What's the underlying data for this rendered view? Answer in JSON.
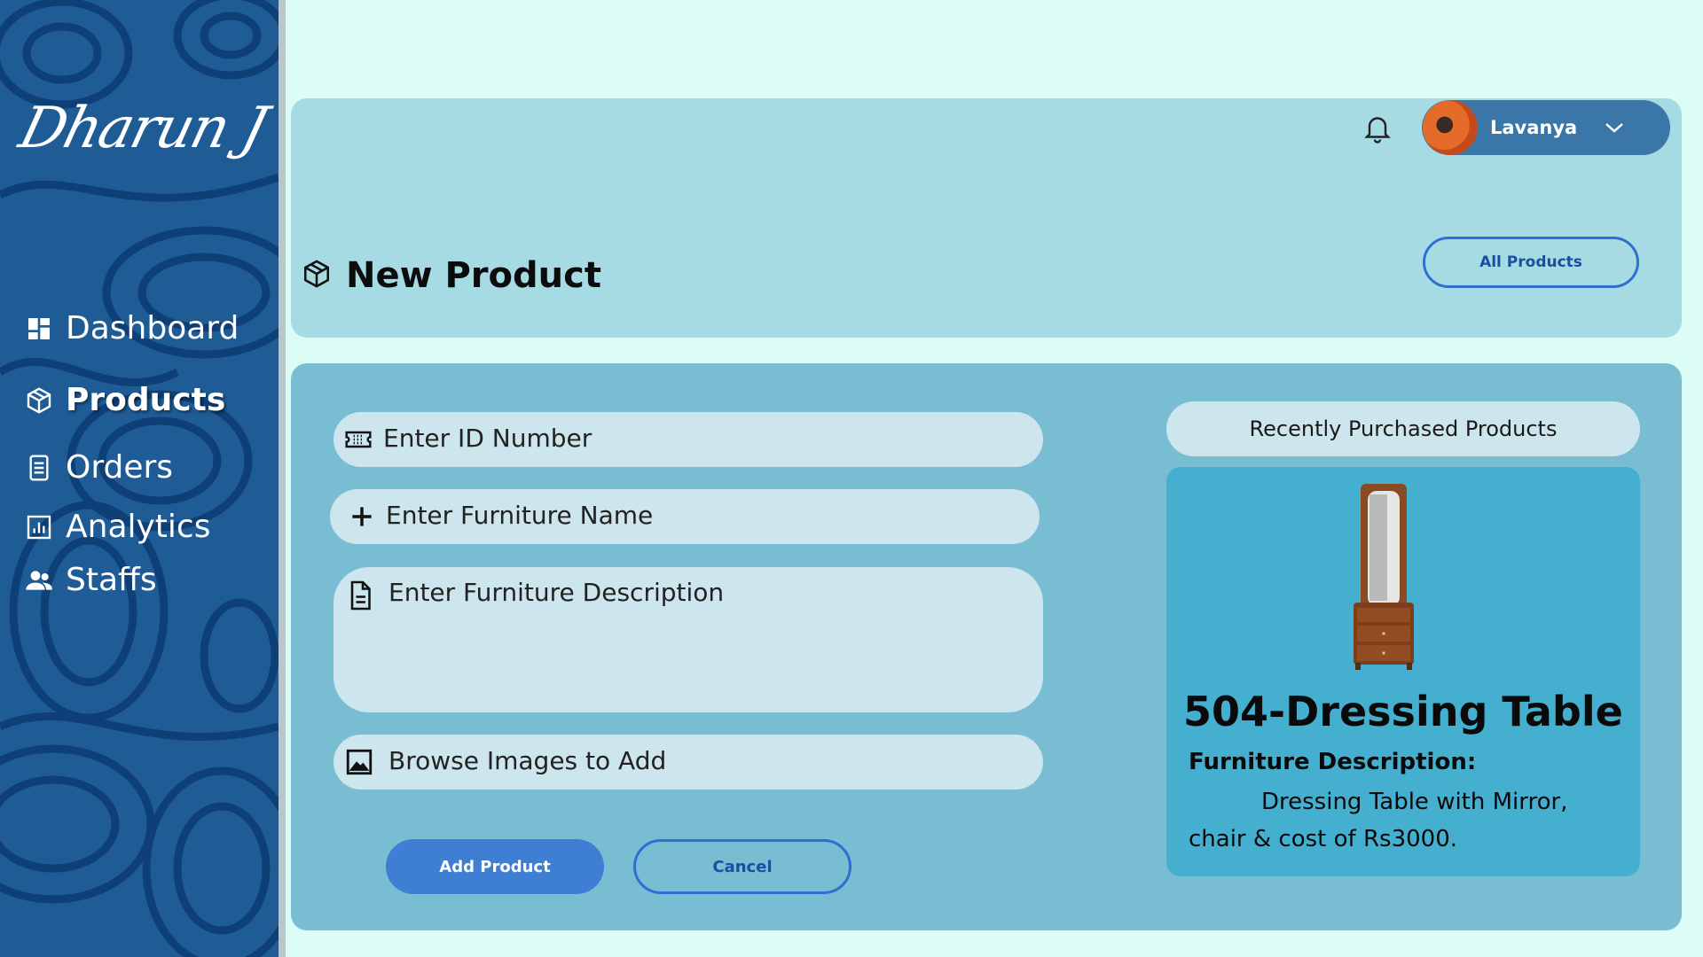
{
  "brand": {
    "signature": "Dharun J"
  },
  "sidebar": {
    "items": [
      {
        "label": "Dashboard",
        "icon": "dashboard-icon",
        "active": false
      },
      {
        "label": "Products",
        "icon": "box-icon",
        "active": true
      },
      {
        "label": "Orders",
        "icon": "orders-icon",
        "active": false
      },
      {
        "label": "Analytics",
        "icon": "analytics-icon",
        "active": false
      },
      {
        "label": "Staffs",
        "icon": "users-icon",
        "active": false
      }
    ]
  },
  "header": {
    "title": "New Product",
    "title_icon": "box-icon",
    "user_name": "Lavanya",
    "all_products_label": "All Products",
    "bell_icon": "bell-icon"
  },
  "form": {
    "id_placeholder": "Enter ID Number",
    "name_placeholder": "Enter Furniture Name",
    "description_placeholder": "Enter Furniture Description",
    "images_placeholder": "Browse Images to Add",
    "add_label": "Add Product",
    "cancel_label": "Cancel"
  },
  "recent": {
    "header": "Recently Purchased Products",
    "product_title": "504-Dressing Table",
    "description_label": "Furniture Description:",
    "description_text": "Dressing Table with Mirror, chair & cost of Rs3000."
  },
  "colors": {
    "page_bg": "#dcfdf6",
    "sidebar_bg": "#1f5c96",
    "header_card": "#a7dbe4",
    "main_card": "#79bdd3",
    "field_bg": "#cde5ec",
    "accent": "#3f7fd3",
    "recent_card": "#45afd0"
  }
}
